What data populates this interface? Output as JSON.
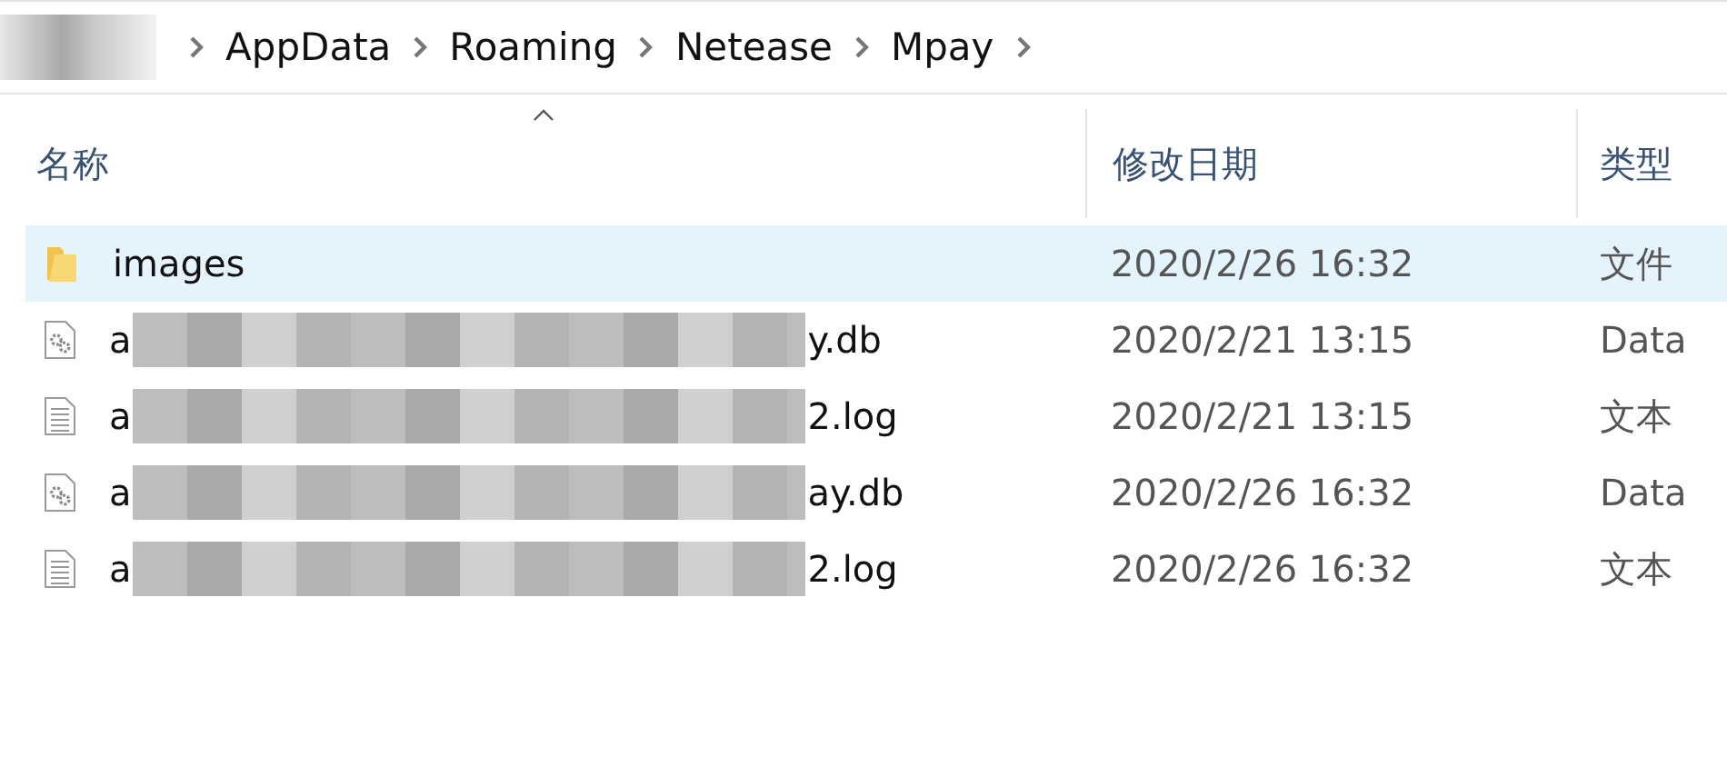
{
  "breadcrumb": {
    "redacted_root": true,
    "items": [
      "AppData",
      "Roaming",
      "Netease",
      "Mpay"
    ]
  },
  "columns": [
    {
      "label": "名称",
      "sorted": true
    },
    {
      "label": "修改日期",
      "sorted": false
    },
    {
      "label": "类型",
      "sorted": false
    }
  ],
  "rows": [
    {
      "kind": "folder",
      "name_start": "images",
      "redacted": false,
      "name_end": "",
      "date": "2020/2/26 16:32",
      "type": "文件",
      "selected": true
    },
    {
      "kind": "db",
      "name_start": "a",
      "redacted": true,
      "name_end": "y.db",
      "date": "2020/2/21 13:15",
      "type": "Data",
      "selected": false
    },
    {
      "kind": "log",
      "name_start": "a",
      "redacted": true,
      "name_end": "2.log",
      "date": "2020/2/21 13:15",
      "type": "文本",
      "selected": false
    },
    {
      "kind": "db",
      "name_start": "a",
      "redacted": true,
      "name_end": "ay.db",
      "date": "2020/2/26 16:32",
      "type": "Data",
      "selected": false
    },
    {
      "kind": "log",
      "name_start": "a",
      "redacted": true,
      "name_end": "2.log",
      "date": "2020/2/26 16:32",
      "type": "文本",
      "selected": false
    }
  ]
}
